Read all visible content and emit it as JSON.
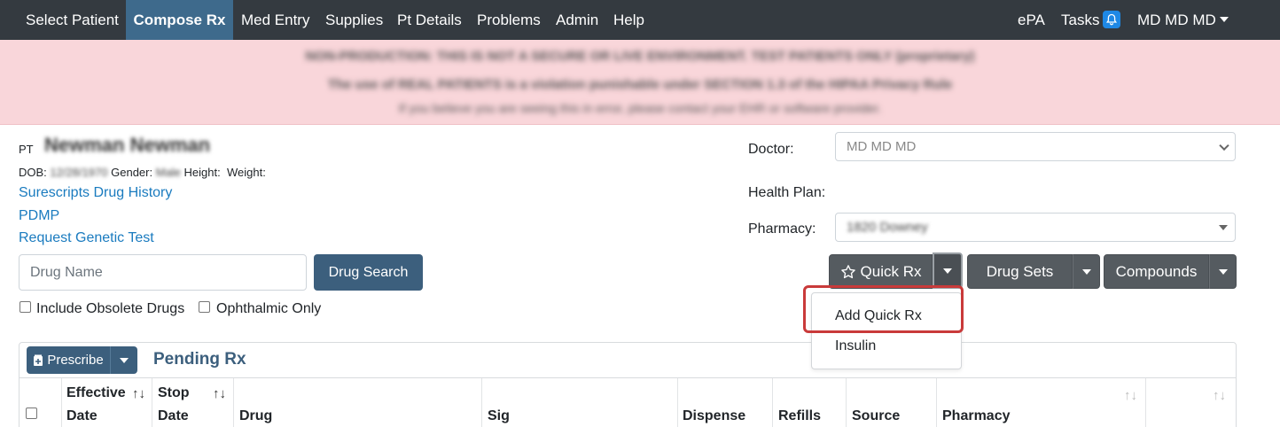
{
  "nav": {
    "items": [
      "Select Patient",
      "Compose Rx",
      "Med Entry",
      "Supplies",
      "Pt Details",
      "Problems",
      "Admin",
      "Help"
    ],
    "right": {
      "epa": "ePA",
      "tasks": "Tasks",
      "user": "MD MD MD"
    }
  },
  "banner": {
    "line1": "NON-PRODUCTION: THIS IS NOT A SECURE OR LIVE ENVIRONMENT. TEST PATIENTS ONLY (proprietary)",
    "line2": "The use of REAL PATIENTS is a violation punishable under SECTION 1.3 of the HIPAA Privacy Rule",
    "line3": "If you believe you are seeing this in error, please contact your EHR or software provider."
  },
  "patient": {
    "pt_label": "PT",
    "name": "Newman Newman",
    "dob_label": "DOB:",
    "dob": "12/28/1970",
    "gender_label": "Gender:",
    "gender": "Male",
    "height_label": "Height:",
    "weight_label": "Weight:",
    "links": [
      "Surescripts Drug History",
      "PDMP",
      "Request Genetic Test"
    ]
  },
  "search": {
    "placeholder": "Drug Name",
    "button": "Drug Search",
    "include_obsolete": "Include Obsolete Drugs",
    "ophthalmic_only": "Ophthalmic Only"
  },
  "right_panel": {
    "doctor_label": "Doctor:",
    "doctor_value": "MD MD MD",
    "health_plan_label": "Health Plan:",
    "pharmacy_label": "Pharmacy:",
    "pharmacy_value": "1820 Downey"
  },
  "buttons": {
    "quick_rx": "Quick Rx",
    "drug_sets": "Drug Sets",
    "compounds": "Compounds"
  },
  "quick_rx_menu": [
    "Add Quick Rx",
    "Insulin"
  ],
  "pending": {
    "prescribe": "Prescribe",
    "title": "Pending Rx",
    "columns": [
      {
        "line1": "Effective",
        "line2": "Date"
      },
      {
        "line1": "Stop",
        "line2": "Date"
      },
      {
        "line1": "",
        "line2": "Drug"
      },
      {
        "line1": "",
        "line2": "Sig"
      },
      {
        "line1": "",
        "line2": "Dispense"
      },
      {
        "line1": "",
        "line2": "Refills"
      },
      {
        "line1": "",
        "line2": "Source"
      },
      {
        "line1": "",
        "line2": "Pharmacy"
      }
    ]
  },
  "colors": {
    "navbar": "#343a40",
    "active_tab": "#3e6a8c",
    "primary_button": "#3c5f7d",
    "link": "#1a7bbf",
    "banner": "#f9d6da",
    "highlight": "#c93a3a"
  }
}
